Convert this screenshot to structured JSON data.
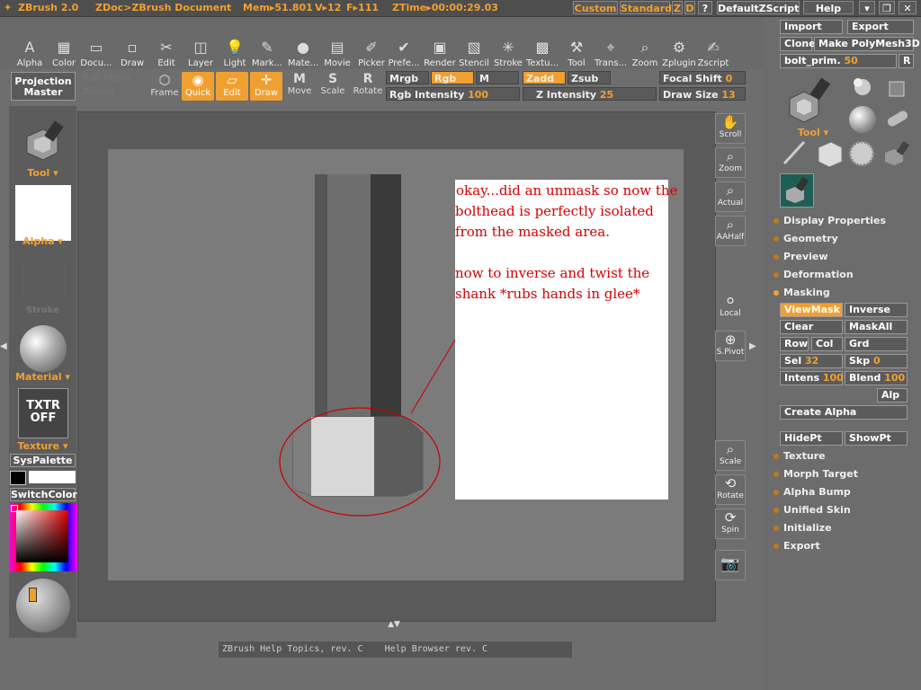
{
  "titlebar": {
    "app": "ZBrush 2.0",
    "doc": "ZDoc>ZBrush Document",
    "mem": "Mem▸51.801",
    "v": "V▸12",
    "f": "F▸111",
    "ztime": "ZTime▸00:00:29.03",
    "custom": "Custom",
    "standard": "Standard",
    "z": "Z",
    "d": "D",
    "q": "?",
    "script": "DefaultZScript",
    "help": "Help"
  },
  "menus": [
    "Alpha",
    "Color",
    "Docu...",
    "Draw",
    "Edit",
    "Layer",
    "Light",
    "Mark...",
    "Mate...",
    "Movie",
    "Prefe...",
    "Picker",
    "Render",
    "Stencil",
    "Stroke",
    "Textu...",
    "Tool",
    "Trans...",
    "Zoom",
    "Zplugin",
    "Zscript"
  ],
  "left": {
    "projection_master": "Projection\nMaster",
    "tool": "Tool",
    "alpha": "Alpha",
    "stroke": "Stroke",
    "material": "Material",
    "txtr": "TXTR\nOFF",
    "texture": "Texture",
    "syspalette": "SysPalette",
    "switchcolor": "SwitchColor"
  },
  "toolbar": {
    "edit_disabled": "Edit",
    "pbsca": "PBSca",
    "tpbrush": "Tbrush",
    "frame": "Frame",
    "quick": "Quick",
    "edit": "Edit",
    "draw": "Draw",
    "move": "Move",
    "scale": "Scale",
    "rotate": "Rotate",
    "mrgb": "Mrgb",
    "rgb": "Rgb",
    "m": "M",
    "zadd": "Zadd",
    "zsub": "Zsub",
    "rgb_intensity_label": "Rgb Intensity",
    "rgb_intensity": "100",
    "z_intensity_label": "Z Intensity",
    "z_intensity": "25",
    "focal_label": "Focal Shift",
    "focal": "0",
    "drawsize_label": "Draw Size",
    "drawsize": "13"
  },
  "dock": [
    "Scroll",
    "Zoom",
    "Actual",
    "AAHalf",
    "Local",
    "S.Pivot",
    "Scale",
    "Rotate",
    "Spin"
  ],
  "note": {
    "line1": "okay...did an unmask so now the",
    "line2": "bolthead is perfectly  isolated",
    "line3": "from the masked area.",
    "line4": "now to inverse and twist the",
    "line5": "shank *rubs hands in glee*"
  },
  "right": {
    "import": "Import",
    "export": "Export",
    "clone": "Clone",
    "make_polymesh": "Make PolyMesh3D",
    "tool_name": "bolt_prim.",
    "tool_value": "50",
    "r": "R",
    "tool": "Tool",
    "sections": [
      "Display Properties",
      "Geometry",
      "Preview",
      "Deformation",
      "Masking"
    ],
    "viewmask": "ViewMask",
    "inverse": "Inverse",
    "clear": "Clear",
    "maskall": "MaskAll",
    "row": "Row",
    "col": "Col",
    "grd": "Grd",
    "sel_label": "Sel",
    "sel": "32",
    "skp_label": "Skp",
    "skp": "0",
    "intens_label": "Intens",
    "intens": "100",
    "blend_label": "Blend",
    "blend": "100",
    "alp": "Alp",
    "create_alpha": "Create Alpha",
    "hidept": "HidePt",
    "showpt": "ShowPt",
    "sections2": [
      "Texture",
      "Morph Target",
      "Alpha Bump",
      "Unified Skin",
      "Initialize",
      "Export"
    ]
  },
  "help": "ZBrush Help Topics, rev. C    Help Browser rev. C",
  "colors": {
    "accent": "#f0a030",
    "note_text": "#d40000",
    "mask_ring": "#cc0000"
  }
}
